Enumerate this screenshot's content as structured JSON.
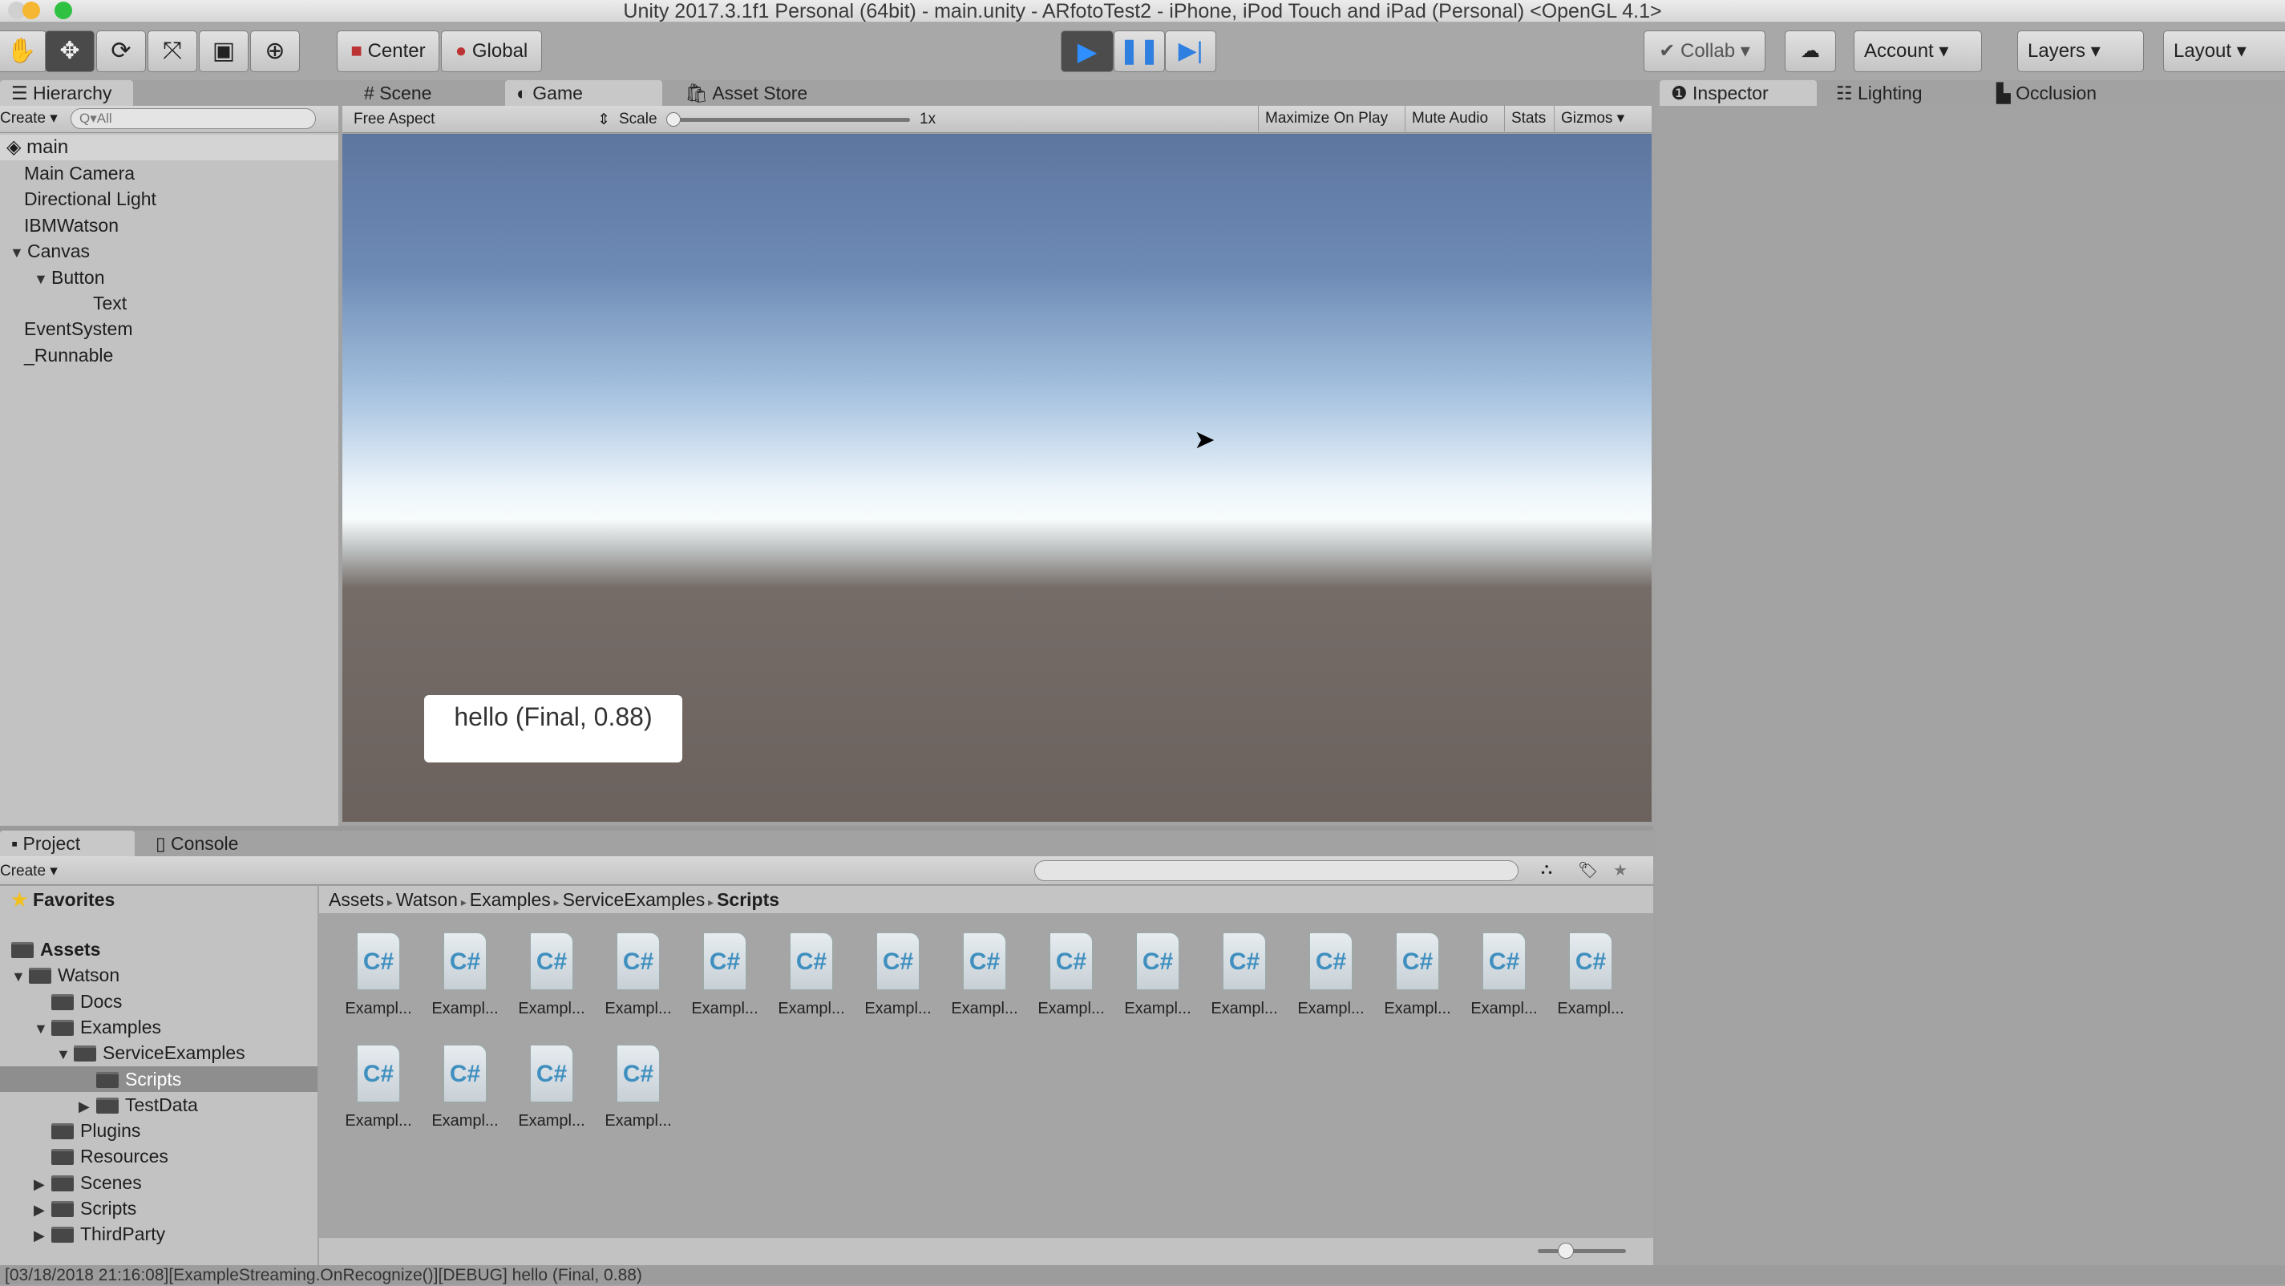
{
  "window": {
    "title": "Unity 2017.3.1f1 Personal (64bit) - main.unity - ARfotoTest2 - iPhone, iPod Touch and iPad (Personal) <OpenGL 4.1>"
  },
  "toolbar": {
    "tools": [
      "hand-icon",
      "move-icon",
      "rotate-icon",
      "scale-icon",
      "rect-icon",
      "transform-icon"
    ],
    "center": "Center",
    "global": "Global",
    "collab": "Collab",
    "account": "Account",
    "layers": "Layers",
    "layout": "Layout",
    "play_color": "#2f7fe0"
  },
  "hierarchy": {
    "tab": "Hierarchy",
    "create": "Create",
    "search_placeholder": "Q▾All",
    "scene": "main",
    "items": [
      {
        "label": "Main Camera",
        "depth": 0
      },
      {
        "label": "Directional Light",
        "depth": 0
      },
      {
        "label": "IBMWatson",
        "depth": 0
      },
      {
        "label": "Canvas",
        "depth": 0,
        "expanded": true
      },
      {
        "label": "Button",
        "depth": 1,
        "expanded": true
      },
      {
        "label": "Text",
        "depth": 2
      },
      {
        "label": "EventSystem",
        "depth": 0
      },
      {
        "label": "_Runnable",
        "depth": 0
      }
    ]
  },
  "center_tabs": [
    "Scene",
    "Game",
    "Asset Store"
  ],
  "game": {
    "aspect": "Free Aspect",
    "scale_label": "Scale",
    "scale_value": "1x",
    "buttons": [
      "Maximize On Play",
      "Mute Audio",
      "Stats",
      "Gizmos"
    ],
    "hello_text": "hello  (Final, 0.88)"
  },
  "inspector_tabs": [
    "Inspector",
    "Lighting",
    "Occlusion"
  ],
  "project": {
    "tabs": [
      "Project",
      "Console"
    ],
    "create": "Create",
    "favorites": "Favorites",
    "tree": [
      {
        "label": "Assets",
        "depth": 0,
        "arrow": ""
      },
      {
        "label": "Watson",
        "depth": 0,
        "arrow": "▼"
      },
      {
        "label": "Docs",
        "depth": 1,
        "arrow": ""
      },
      {
        "label": "Examples",
        "depth": 1,
        "arrow": "▼"
      },
      {
        "label": "ServiceExamples",
        "depth": 2,
        "arrow": "▼"
      },
      {
        "label": "Scripts",
        "depth": 3,
        "arrow": "",
        "selected": true
      },
      {
        "label": "TestData",
        "depth": 3,
        "arrow": "▶"
      },
      {
        "label": "Plugins",
        "depth": 1,
        "arrow": ""
      },
      {
        "label": "Resources",
        "depth": 1,
        "arrow": ""
      },
      {
        "label": "Scenes",
        "depth": 1,
        "arrow": "▶"
      },
      {
        "label": "Scripts",
        "depth": 1,
        "arrow": "▶"
      },
      {
        "label": "ThirdParty",
        "depth": 1,
        "arrow": "▶"
      }
    ],
    "breadcrumb": [
      "Assets",
      "Watson",
      "Examples",
      "ServiceExamples",
      "Scripts"
    ],
    "asset_label": "Exampl...",
    "asset_icon": "C#",
    "asset_count": 19
  },
  "status": {
    "message": "[03/18/2018 21:16:08][ExampleStreaming.OnRecognize()][DEBUG] hello  (Final, 0.88)"
  }
}
